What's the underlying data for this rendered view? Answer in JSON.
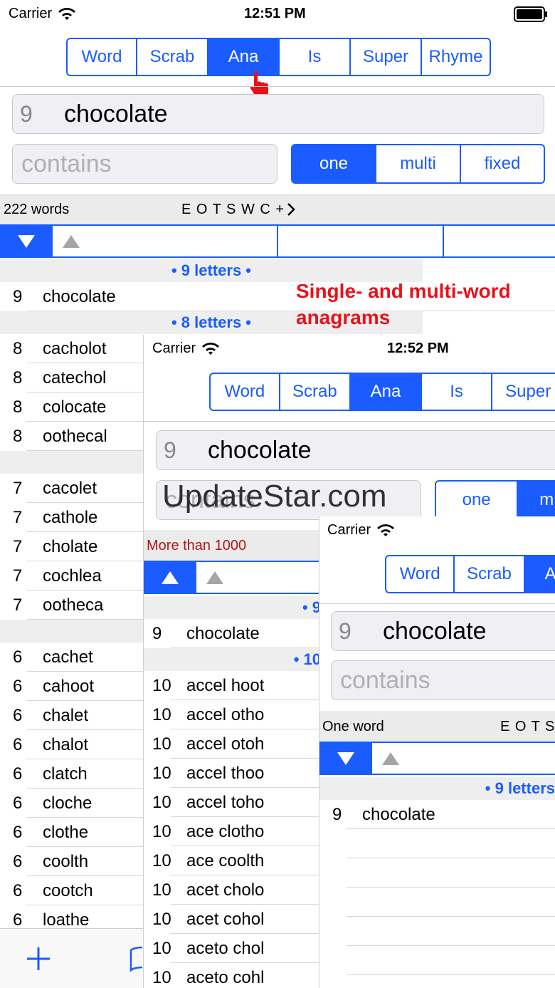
{
  "colors": {
    "accent": "#1a5cff",
    "annotation": "#e8121b",
    "warning": "#b3141b"
  },
  "screen1": {
    "status": {
      "carrier": "Carrier",
      "time": "12:51 PM"
    },
    "tabs": [
      "Word",
      "Scrab",
      "Ana",
      "Is",
      "Super",
      "Rhyme"
    ],
    "selected_tab": "Ana",
    "word_field": {
      "length": "9",
      "value": "chocolate"
    },
    "contains_placeholder": "contains",
    "mode": [
      "one",
      "multi",
      "fixed"
    ],
    "count": "222 words",
    "letters": "E O T S W C + ",
    "sections": {
      "nine": "• 9 letters •",
      "eight": "• 8 letters •"
    },
    "rows_9": [
      [
        "9",
        "chocolate"
      ]
    ],
    "rows_8": [
      [
        "8",
        "cacholot"
      ],
      [
        "8",
        "catechol"
      ],
      [
        "8",
        "colocate"
      ],
      [
        "8",
        "oothecal"
      ]
    ],
    "rows_7": [
      [
        "7",
        "cacolet"
      ],
      [
        "7",
        "cathole"
      ],
      [
        "7",
        "cholate"
      ],
      [
        "7",
        "cochlea"
      ],
      [
        "7",
        "ootheca"
      ]
    ],
    "rows_6": [
      [
        "6",
        "cachet"
      ],
      [
        "6",
        "cahoot"
      ],
      [
        "6",
        "chalet"
      ],
      [
        "6",
        "chalot"
      ],
      [
        "6",
        "clatch"
      ],
      [
        "6",
        "cloche"
      ],
      [
        "6",
        "clothe"
      ],
      [
        "6",
        "coolth"
      ],
      [
        "6",
        "cootch"
      ],
      [
        "6",
        "loathe"
      ]
    ]
  },
  "annotation": "Single- and multi-word anagrams",
  "watermark": "UpdateStar.com",
  "screen2": {
    "status": {
      "carrier": "Carrier",
      "time": "12:52 PM"
    },
    "tabs": [
      "Word",
      "Scrab",
      "Ana",
      "Is",
      "Super"
    ],
    "word_field": {
      "length": "9",
      "value": "chocolate"
    },
    "contains_placeholder": "contains",
    "mode": [
      "one",
      "m"
    ],
    "count": "More than 1000",
    "sections": {
      "nine": "• 9",
      "ten": "• 10"
    },
    "rows_9": [
      [
        "9",
        "chocolate"
      ]
    ],
    "rows_10": [
      [
        "10",
        "accel hoot"
      ],
      [
        "10",
        "accel otho"
      ],
      [
        "10",
        "accel otoh"
      ],
      [
        "10",
        "accel thoo"
      ],
      [
        "10",
        "accel toho"
      ],
      [
        "10",
        "ace clotho"
      ],
      [
        "10",
        "ace coolth"
      ],
      [
        "10",
        "acet cholo"
      ],
      [
        "10",
        "acet cohol"
      ],
      [
        "10",
        "aceto chol"
      ],
      [
        "10",
        "aceto cohl"
      ]
    ]
  },
  "screen3": {
    "status": {
      "carrier": "Carrier"
    },
    "tabs": [
      "Word",
      "Scrab",
      "A"
    ],
    "word_field": {
      "length": "9",
      "value": "chocolate"
    },
    "contains_placeholder": "contains",
    "count": "One word",
    "letters": "E O T S",
    "sections": {
      "nine": "• 9 letters"
    },
    "rows_9": [
      [
        "9",
        "chocolate"
      ]
    ]
  }
}
